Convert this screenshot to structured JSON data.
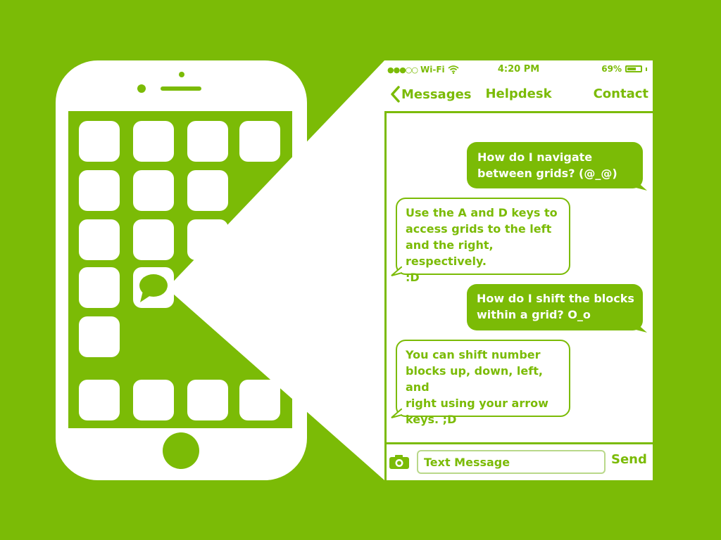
{
  "status_bar": {
    "signal": "●●●○○",
    "carrier": "Wi-Fi",
    "time": "4:20 PM",
    "battery": "69%",
    "battery_level": 0.69
  },
  "nav": {
    "back_label": "Messages",
    "title": "Helpdesk",
    "right_label": "Contact"
  },
  "messages": [
    {
      "direction": "outgoing",
      "lines": [
        "How do I navigate",
        "between grids? (@_@)"
      ]
    },
    {
      "direction": "incoming",
      "lines": [
        "Use the A and D keys to",
        "access grids to the left",
        "and the right, respectively.",
        ":D"
      ]
    },
    {
      "direction": "outgoing",
      "lines": [
        "How do I shift the blocks",
        "within a grid? O_o"
      ]
    },
    {
      "direction": "incoming",
      "lines": [
        "You can shift number",
        "blocks up, down, left, and",
        "right using your arrow",
        "keys. ;D"
      ]
    }
  ],
  "compose": {
    "placeholder": "Text Message",
    "send_label": "Send"
  },
  "colors": {
    "brand_green": "#7bbb06",
    "white": "#ffffff"
  },
  "icons": [
    "wifi-icon",
    "battery-icon",
    "back-chevron-icon",
    "camera-icon",
    "message-app-icon",
    "home-button-icon"
  ]
}
